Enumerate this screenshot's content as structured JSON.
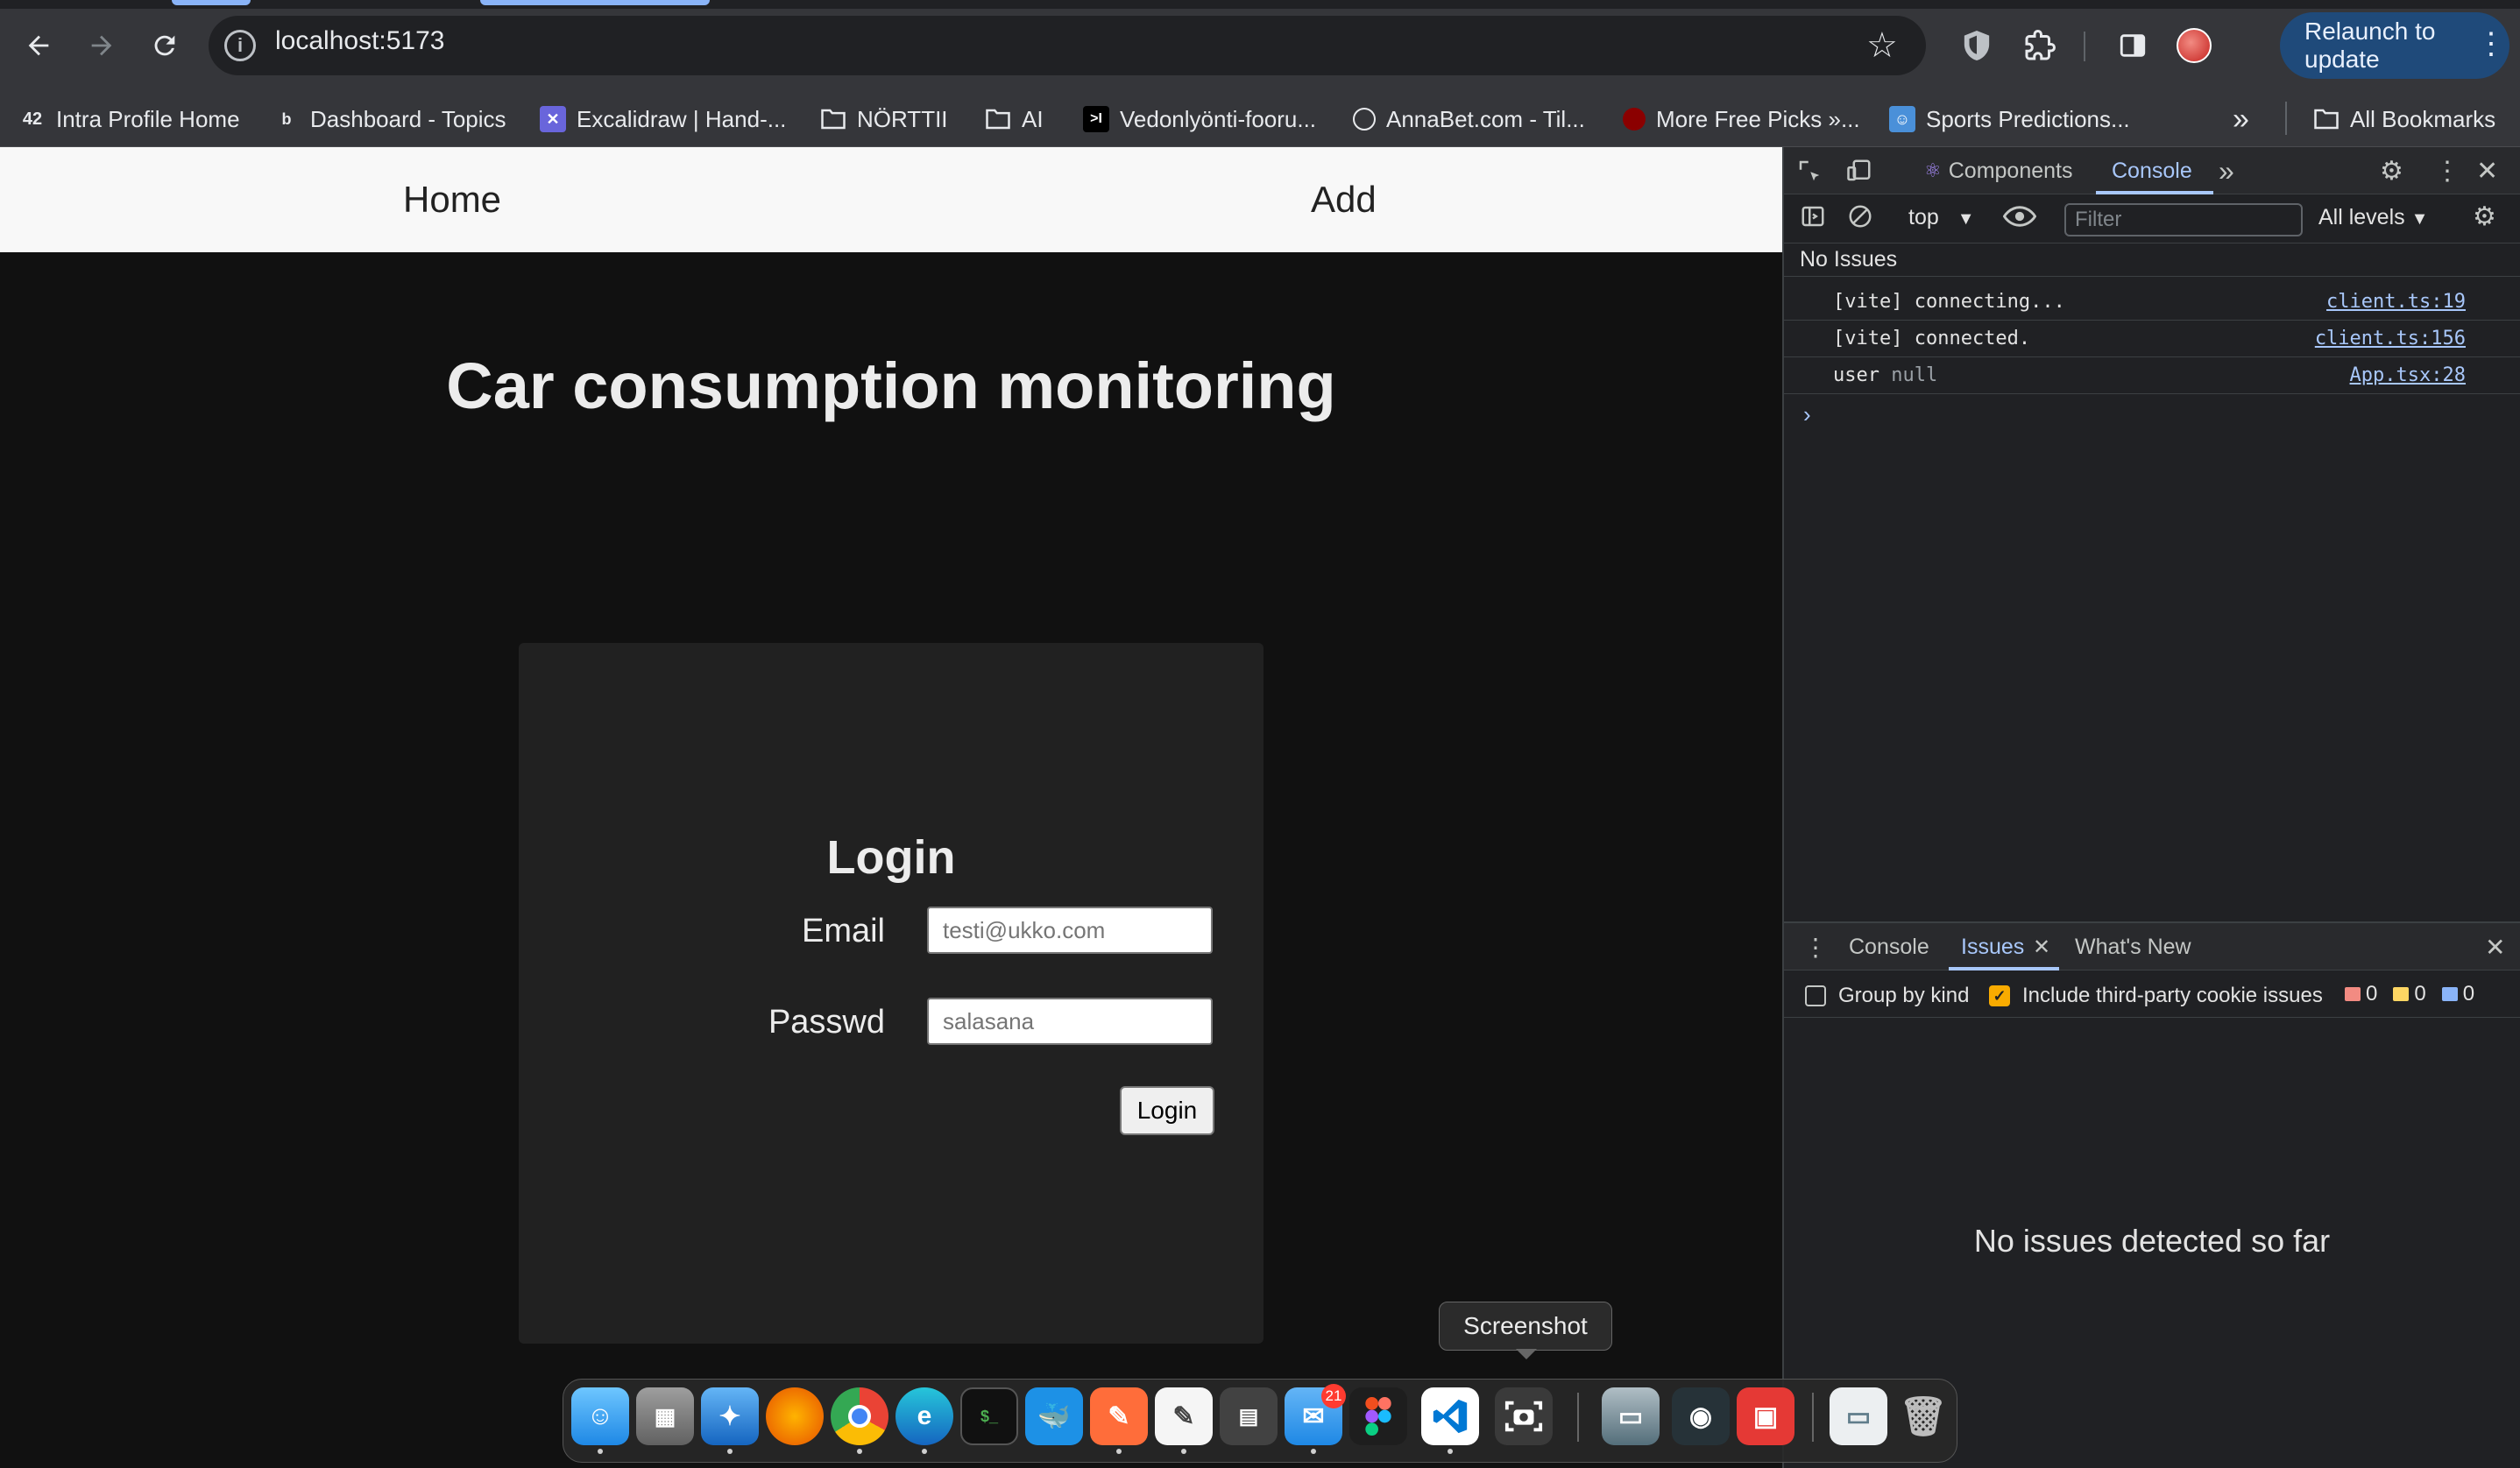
{
  "browser": {
    "url": "localhost:5173",
    "relaunch_label": "Relaunch to update",
    "bookmarks": [
      {
        "label": "Intra Profile Home",
        "icon": "42-logo-icon"
      },
      {
        "label": "Dashboard - Topics",
        "icon": "brand-icon"
      },
      {
        "label": "Excalidraw | Hand-...",
        "icon": "excalidraw-icon"
      },
      {
        "label": "NÖRTTII",
        "icon": "folder-icon"
      },
      {
        "label": "AI",
        "icon": "folder-icon"
      },
      {
        "label": "Vedonlyönti-fooru...",
        "icon": "terminal-icon"
      },
      {
        "label": "AnnaBet.com - Til...",
        "icon": "ball-icon"
      },
      {
        "label": "More Free Picks »...",
        "icon": "shield-icon"
      },
      {
        "label": "Sports Predictions...",
        "icon": "cartoon-icon"
      }
    ],
    "more_bookmarks": "»",
    "all_bookmarks": "All Bookmarks"
  },
  "app": {
    "nav": {
      "home": "Home",
      "add": "Add"
    },
    "title": "Car consumption monitoring",
    "login": {
      "heading": "Login",
      "email_label": "Email",
      "email_placeholder": "testi@ukko.com",
      "password_label": "Passwd",
      "password_placeholder": "salasana",
      "submit_label": "Login"
    }
  },
  "devtools": {
    "tabs": {
      "components": "Components",
      "console": "Console",
      "more": "»"
    },
    "context": "top",
    "filter_placeholder": "Filter",
    "levels": "All levels",
    "issues_line": "No Issues",
    "logs": [
      {
        "message": "[vite] connecting...",
        "source": "client.ts:19"
      },
      {
        "message": "[vite] connected.",
        "source": "client.ts:156"
      },
      {
        "message": "user",
        "value": "null",
        "source": "App.tsx:28"
      }
    ],
    "prompt": "›",
    "drawer": {
      "tabs": {
        "console": "Console",
        "issues": "Issues",
        "whats_new": "What's New"
      },
      "group_by_kind": "Group by kind",
      "third_party": "Include third-party cookie issues",
      "counts": {
        "errors": "0",
        "warnings": "0",
        "info": "0"
      },
      "empty_message": "No issues detected so far"
    }
  },
  "dock": {
    "tooltip": "Screenshot",
    "mail_badge": "21"
  },
  "colors": {
    "accent": "#a8c7fa",
    "relaunch_bg": "#1f4a7a",
    "page_bg": "#111111",
    "card_bg": "#212121"
  }
}
